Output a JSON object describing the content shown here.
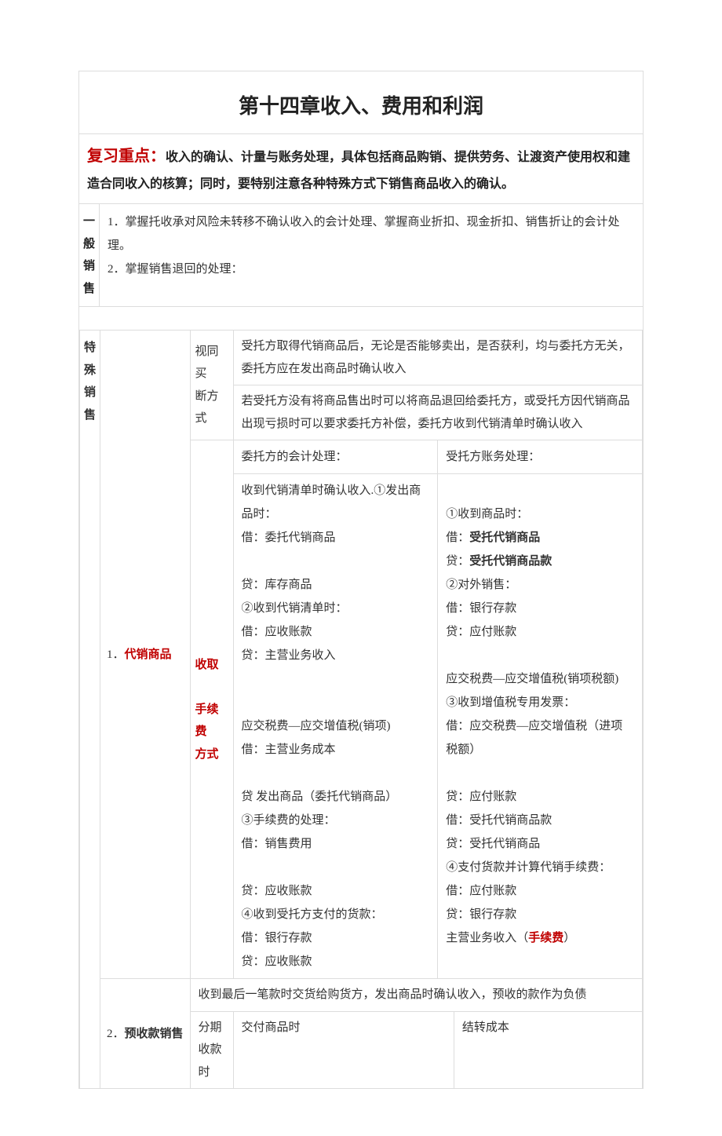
{
  "title": "第十四章收入、费用和利润",
  "fuxi": {
    "label": "复习重点：",
    "text": "收入的确认、计量与账务处理，具体包括商品购销、提供劳务、让渡资产使用权和建造合同收入的核算；同时，要特别注意各种特殊方式下销售商品收入的确认。"
  },
  "yiban": {
    "label_chars": [
      "一",
      "般",
      "销",
      "售"
    ],
    "p1": "1．掌握托收承对风险未转移不确认收入的会计处理、掌握商业折扣、现金折扣、销售折让的会计处理。",
    "p2": "2．掌握销售退回的处理："
  },
  "teshu": {
    "label_chars": [
      "特",
      "殊",
      "销",
      "售"
    ],
    "item1_num": "1．",
    "item1_name": "代销商品",
    "method1_l1": "视同买",
    "method1_l2": "断方式",
    "m1_desc1": "受托方取得代销商品后，无论是否能够卖出，是否获利，均与委托方无关，委托方应在发出商品时确认收入",
    "m1_desc2": "若受托方没有将商品售出时可以将商品退回给委托方，或受托方因代销商品出现亏损时可以要求委托方补偿，委托方收到代销清单时确认收入",
    "method2_l1": "收取",
    "method2_l2": "手续费",
    "method2_l3": "方式",
    "acct_left_header": "委托方的会计处理：",
    "acct_right_header": "受托方账务处理：",
    "acct_left_p1": "收到代销清单时确认收入.①发出商品时：",
    "acct_left_p2": "借：委托代销商品",
    "acct_left_p3": "贷：库存商品",
    "acct_left_p4": "②收到代销清单时：",
    "acct_left_p5": "借：应收账款",
    "acct_left_p6": "贷：主营业务收入",
    "acct_left_p7": "应交税费—应交增值税(销项)",
    "acct_left_p8": "借：主营业务成本",
    "acct_left_p9": "贷 发出商品（委托代销商品）",
    "acct_left_p10": "③手续费的处理：",
    "acct_left_p11": "借：销售费用",
    "acct_left_p12": "贷：应收账款",
    "acct_left_p13": "④收到受托方支付的货款：",
    "acct_left_p14": "借：银行存款",
    "acct_left_p15": "贷：应收账款",
    "acct_right_p1": "①收到商品时：",
    "acct_right_p2a": "借：",
    "acct_right_p2b": "受托代销商品",
    "acct_right_p3a": "贷：",
    "acct_right_p3b": "受托代销商品款",
    "acct_right_p4": "②对外销售：",
    "acct_right_p5": "借：银行存款",
    "acct_right_p6": "贷：应付账款",
    "acct_right_p7": "应交税费—应交增值税(销项税额)",
    "acct_right_p8": "③收到增值税专用发票：",
    "acct_right_p9": "借：应交税费—应交增值税（进项税额）",
    "acct_right_p10": "贷：应付账款",
    "acct_right_p11": "借：受托代销商品款",
    "acct_right_p12": "贷：受托代销商品",
    "acct_right_p13": "④支付货款并计算代销手续费：",
    "acct_right_p14": "借：应付账款",
    "acct_right_p15": "贷：银行存款",
    "acct_right_p16a": "主营业务收入（",
    "acct_right_p16b": "手续费",
    "acct_right_p16c": "）",
    "item2_num": "2．",
    "item2_name": "预收款销售",
    "item2_desc": "收到最后一笔款时交货给购货方，发出商品时确认收入，预收的款作为负债",
    "item2_c1": "分期收款时",
    "item2_c2": "交付商品时",
    "item2_c3": "结转成本"
  }
}
